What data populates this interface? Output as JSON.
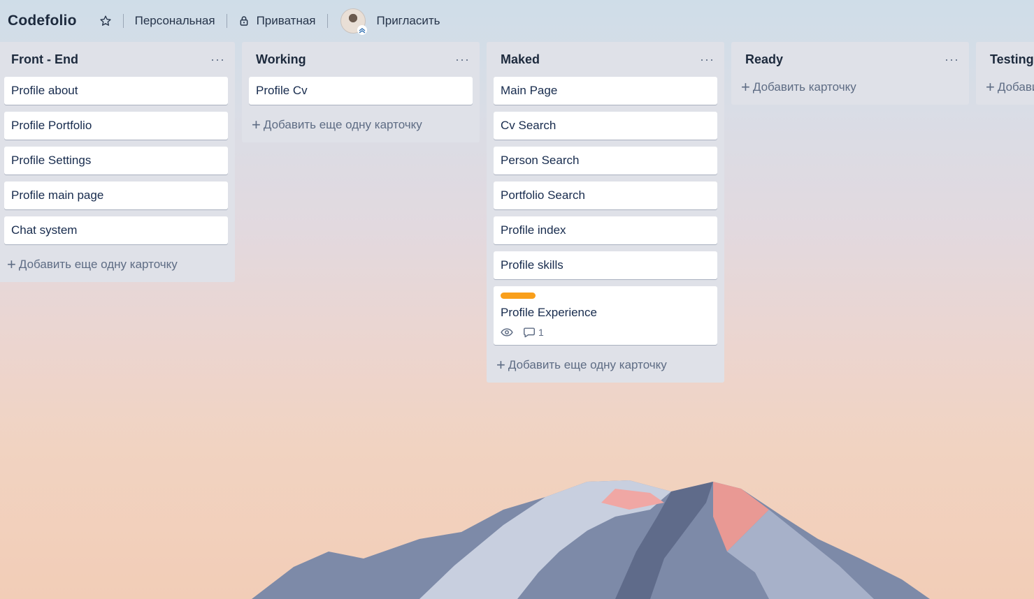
{
  "header": {
    "board_title": "Codefolio",
    "visibility_workspace": "Персональная",
    "visibility_privacy": "Приватная",
    "invite_label": "Пригласить",
    "star_icon": "star-icon",
    "lock_icon": "lock-icon"
  },
  "lists": [
    {
      "title": "Front - End",
      "cards": [
        "Profile about",
        "Profile Portfolio",
        "Profile Settings",
        "Profile main page",
        "Chat system"
      ],
      "add_label": "Добавить еще одну карточку"
    },
    {
      "title": "Working",
      "cards": [
        "Profile Cv"
      ],
      "add_label": "Добавить еще одну карточку"
    },
    {
      "title": "Maked",
      "cards": [
        "Main Page",
        "Cv Search",
        "Person Search",
        "Portfolio Search",
        "Profile index",
        "Profile skills"
      ],
      "rich_card": {
        "title": "Profile Experience",
        "label_color": "#f99f1b",
        "comments": "1"
      },
      "add_label": "Добавить еще одну карточку"
    },
    {
      "title": "Ready",
      "cards": [],
      "add_label": "Добавить карточку"
    },
    {
      "title": "Testing",
      "cards": [],
      "add_label": "Добавить карточку"
    }
  ],
  "list_menu_label": "···",
  "colors": {
    "list_bg": "#dfe1e8",
    "card_bg": "#ffffff",
    "label_orange": "#f99f1b"
  }
}
